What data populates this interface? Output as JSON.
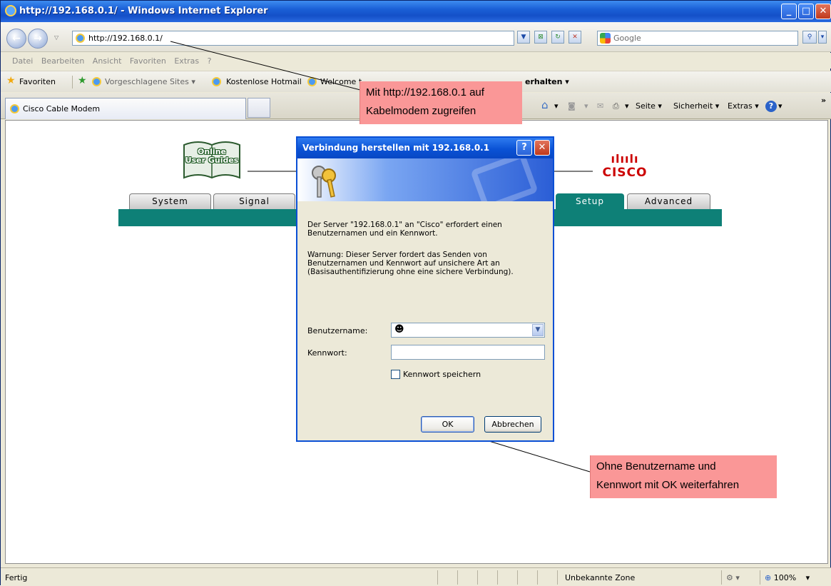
{
  "window": {
    "title": "http://192.168.0.1/ - Windows Internet Explorer"
  },
  "address": {
    "url": "http://192.168.0.1/",
    "search_placeholder": "Google"
  },
  "menu": [
    "Datei",
    "Bearbeiten",
    "Ansicht",
    "Favoriten",
    "Extras",
    "?"
  ],
  "favorites": {
    "label": "Favoriten",
    "suggested": "Vorgeschlagene Sites ▾",
    "hotmail": "Kostenlose Hotmail",
    "welcome": "Welcome t",
    "more": "erhalten ▾"
  },
  "tabs": {
    "active": "Cisco Cable Modem"
  },
  "commands": {
    "seite": "Seite ▾",
    "sicherheit": "Sicherheit ▾",
    "extras": "Extras ▾",
    "chevron": "»"
  },
  "cisco": {
    "guides": [
      "Online",
      "User Guides"
    ],
    "logo_bars": "ılıılı",
    "logo_word": "CISCO",
    "tabs": [
      "System",
      "Signal",
      "Setup",
      "Advanced"
    ]
  },
  "dialog": {
    "title": "Verbindung herstellen mit 192.168.0.1",
    "help": "?",
    "close": "✕",
    "message1_line1": "Der Server \"192.168.0.1\" an \"Cisco\" erfordert einen",
    "message1_line2": "Benutzernamen und ein Kennwort.",
    "message2_line1": "Warnung: Dieser Server fordert das Senden von",
    "message2_line2": "Benutzernamen und Kennwort auf unsichere Art an",
    "message2_line3": "(Basisauthentifizierung ohne eine sichere Verbindung).",
    "username_label": "Benutzername:",
    "password_label": "Kennwort:",
    "save_label": "Kennwort speichern",
    "ok": "OK",
    "cancel": "Abbrechen"
  },
  "callouts": {
    "top_line1": "Mit http://192.168.0.1 auf",
    "top_line2": "Kabelmodem zugreifen",
    "bottom_line1": "Ohne Benutzername und",
    "bottom_line2": "Kennwort mit OK weiterfahren"
  },
  "status": {
    "text": "Fertig",
    "zone": "Unbekannte Zone",
    "zoom": "100%"
  },
  "colors": {
    "titlebar": "#1a5fd6",
    "cisco_teal": "#0e8077",
    "callout": "#fa9797",
    "cisco_red": "#cc0000"
  }
}
